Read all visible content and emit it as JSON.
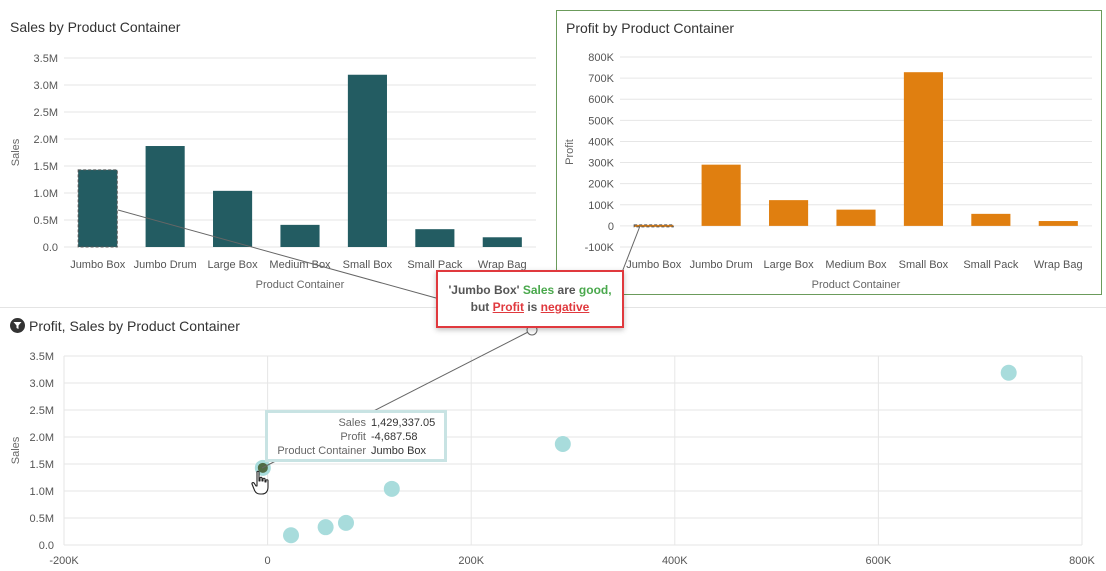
{
  "sales_chart": {
    "title": "Sales by Product Container",
    "ylabel": "Sales",
    "xlabel": "Product Container",
    "bar_color": "#235c62",
    "chart_data": {
      "type": "bar",
      "categories": [
        "Jumbo Box",
        "Jumbo Drum",
        "Large Box",
        "Medium Box",
        "Small Box",
        "Small Pack",
        "Wrap Bag"
      ],
      "values": [
        1429337.05,
        1870000,
        1040000,
        410000,
        3190000,
        330000,
        180000
      ],
      "ylim": [
        0,
        3500000
      ],
      "yticks": [
        0,
        500000,
        1000000,
        1500000,
        2000000,
        2500000,
        3000000,
        3500000
      ],
      "ytick_labels": [
        "0.0",
        "0.5M",
        "1.0M",
        "1.5M",
        "2.0M",
        "2.5M",
        "3.0M",
        "3.5M"
      ],
      "selected": "Jumbo Box"
    }
  },
  "profit_chart": {
    "title": "Profit by Product Container",
    "ylabel": "Profit",
    "xlabel": "Product Container",
    "bar_color": "#e07f10",
    "chart_data": {
      "type": "bar",
      "categories": [
        "Jumbo Box",
        "Jumbo Drum",
        "Large Box",
        "Medium Box",
        "Small Box",
        "Small Pack",
        "Wrap Bag"
      ],
      "values": [
        -4687.58,
        290000,
        122000,
        77000,
        728000,
        57000,
        23000
      ],
      "ylim": [
        -100000,
        800000
      ],
      "yticks": [
        -100000,
        0,
        100000,
        200000,
        300000,
        400000,
        500000,
        600000,
        700000,
        800000
      ],
      "ytick_labels": [
        "-100K",
        "0",
        "100K",
        "200K",
        "300K",
        "400K",
        "500K",
        "600K",
        "700K",
        "800K"
      ],
      "selected": "Jumbo Box"
    }
  },
  "scatter_chart": {
    "title": "Profit, Sales by Product Container",
    "ylabel": "Sales",
    "point_color": "#a8dcdc",
    "selected_color": "#4f6b45",
    "chart_data": {
      "type": "scatter",
      "series": [
        {
          "points": [
            {
              "x": -4687.58,
              "y": 1429337.05,
              "label": "Jumbo Box"
            },
            {
              "x": 290000,
              "y": 1870000,
              "label": "Jumbo Drum"
            },
            {
              "x": 122000,
              "y": 1040000,
              "label": "Large Box"
            },
            {
              "x": 77000,
              "y": 410000,
              "label": "Medium Box"
            },
            {
              "x": 728000,
              "y": 3190000,
              "label": "Small Box"
            },
            {
              "x": 57000,
              "y": 330000,
              "label": "Small Pack"
            },
            {
              "x": 23000,
              "y": 180000,
              "label": "Wrap Bag"
            }
          ]
        }
      ],
      "xlim": [
        -200000,
        800000
      ],
      "ylim": [
        0,
        3500000
      ],
      "xticks": [
        -200000,
        0,
        200000,
        400000,
        600000,
        800000
      ],
      "xtick_labels": [
        "-200K",
        "0",
        "200K",
        "400K",
        "600K",
        "800K"
      ],
      "yticks": [
        0,
        500000,
        1000000,
        1500000,
        2000000,
        2500000,
        3000000,
        3500000
      ],
      "ytick_labels": [
        "0.0",
        "0.5M",
        "1.0M",
        "1.5M",
        "2.0M",
        "2.5M",
        "3.0M",
        "3.5M"
      ],
      "selected": "Jumbo Box"
    }
  },
  "callout": {
    "item": "'Jumbo Box'",
    "sales_word": "Sales",
    "are": "are",
    "good": "good,",
    "but": "but",
    "profit_word": "Profit",
    "is": "is",
    "negative": "negative"
  },
  "tooltip": {
    "rows": [
      {
        "key": "Sales",
        "value": "1,429,337.05"
      },
      {
        "key": "Profit",
        "value": "-4,687.58"
      },
      {
        "key": "Product Container",
        "value": "Jumbo Box"
      }
    ]
  }
}
